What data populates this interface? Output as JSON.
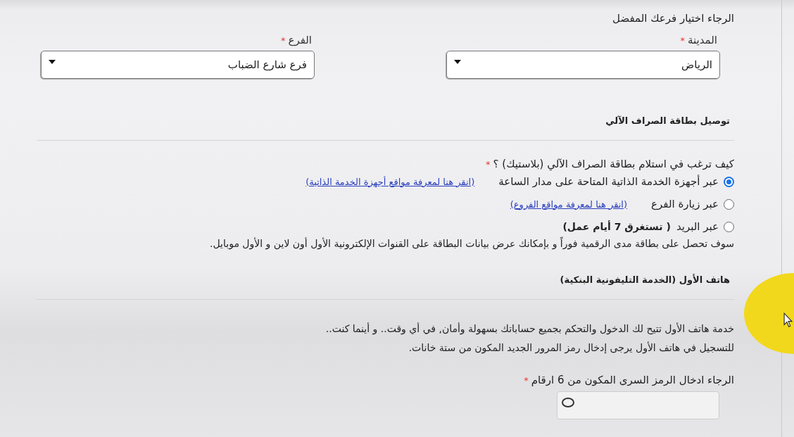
{
  "branch_prompt": "الرجاء اختيار فرعك المفضل",
  "selects": [
    {
      "label": "المدينة",
      "required_mark": "*",
      "value": "الرياض"
    },
    {
      "label": "الفرع",
      "required_mark": "*",
      "value": "فرع شارع الضباب"
    }
  ],
  "card_delivery": {
    "heading": "توصيل بطاقة الصراف الآلي",
    "question": "كيف ترغب في استلام بطاقة الصراف الآلي (بلاستيك) ؟",
    "required_mark": "*",
    "options": [
      {
        "label": "عبر أجهزة الخدمة الذاتية المتاحة على مدار الساعة",
        "selected": true,
        "link": "(انقر هنا لمعرفة مواقع أجهزة الخدمة الذاتية)"
      },
      {
        "label": "عبر زيارة الفرع",
        "selected": false,
        "link": "(انقر هنا لمعرفة مواقع الفروع)"
      },
      {
        "label": "عبر البريد",
        "selected": false,
        "note": "( تستغرق 7 أيام عمل)"
      }
    ],
    "info": "سوف تحصل على بطاقة مدى الرقمية فوراً و بإمكانك عرض بيانات البطاقة على القنوات الإلكترونية الأول أون لاين و الأول موبايل."
  },
  "phone_banking": {
    "heading": "هاتف الأول (الخدمة التليفونية البنكية)",
    "paragraphs": [
      "خدمة هاتف الأول تتيح لك الدخول والتحكم بجميع حساباتك بسهولة وأمان, في أي وقت.. و أينما كنت..",
      "للتسجيل في هاتف الأول يرجى إدخال رمز المرور الجديد المكون من ستة خانات."
    ],
    "pin_label": "الرجاء ادخال الرمز السرى المكون من 6 ارقام",
    "required_mark": "*",
    "pin_field": {
      "kind": "password"
    }
  }
}
